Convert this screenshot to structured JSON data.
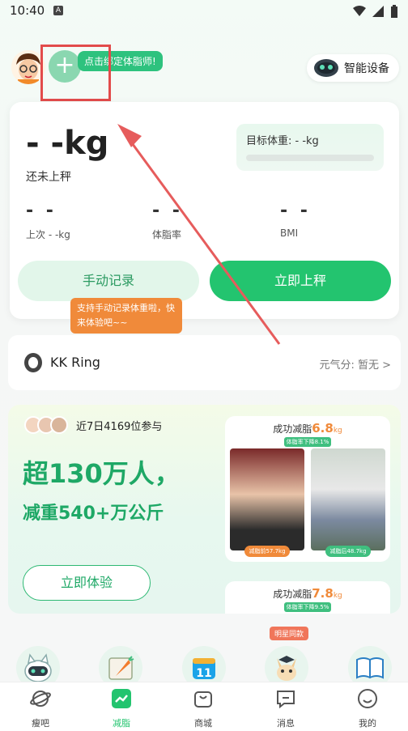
{
  "status_bar": {
    "time": "10:40",
    "notification_letter": "A"
  },
  "header": {
    "bind_hint": "点击绑定体脂师!",
    "smart_device_label": "智能设备"
  },
  "weight_card": {
    "weight": "- -kg",
    "status": "还未上秤",
    "target_label": "目标体重: - -kg",
    "metrics": [
      {
        "value": "- -",
        "label": "上次 - -kg"
      },
      {
        "value": "- -",
        "label": "体脂率"
      },
      {
        "value": "- -",
        "label": "BMI"
      }
    ],
    "manual_record": "手动记录",
    "weigh_now": "立即上秤",
    "tip": "支持手动记录体重啦，快来体验吧~~"
  },
  "ring": {
    "name": "KK Ring",
    "score_label": "元气分: 暂无 >"
  },
  "promo": {
    "participants": "近7日4169位参与",
    "headline": "超130万人，",
    "subline": "减重540+万公斤",
    "try_button": "立即体验",
    "stories": [
      {
        "prefix": "成功减脂",
        "amount": "6.8",
        "unit": "kg",
        "tag": "体脂率下降8.1%",
        "before": "减脂前57.7kg",
        "after": "减脂后48.7kg"
      },
      {
        "prefix": "成功减脂",
        "amount": "7.8",
        "unit": "kg",
        "tag": "体脂率下降9.5%"
      }
    ]
  },
  "shortcuts": {
    "star_badge": "明星同款"
  },
  "tabs": [
    {
      "label": "瘦吧"
    },
    {
      "label": "减脂"
    },
    {
      "label": "商城"
    },
    {
      "label": "消息"
    },
    {
      "label": "我的"
    }
  ],
  "colors": {
    "accent": "#23c46f",
    "tip": "#f08a3a",
    "annotation": "#e24b4b"
  }
}
